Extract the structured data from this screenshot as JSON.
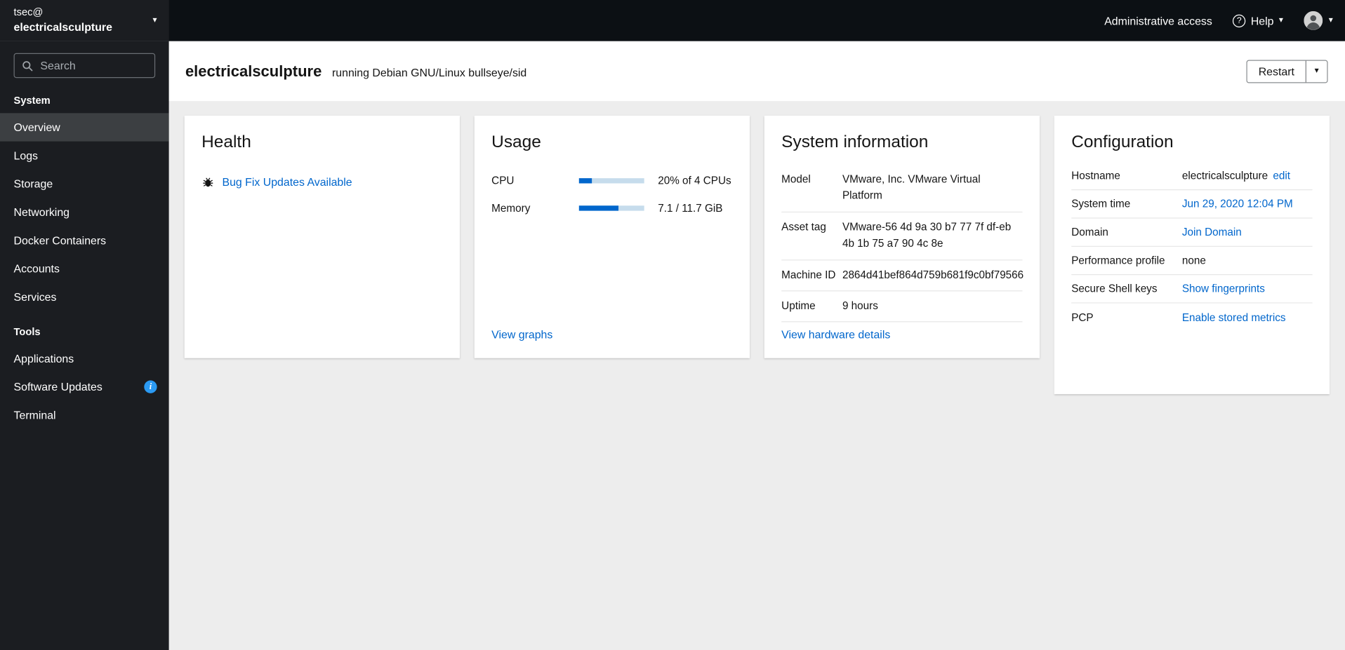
{
  "masthead": {
    "admin_access_label": "Administrative access",
    "help_label": "Help"
  },
  "sidebar": {
    "user_line1": "tsec@",
    "user_line2": "electricalsculpture",
    "search_placeholder": "Search",
    "sections": [
      {
        "label": "System",
        "items": [
          {
            "label": "Overview",
            "active": true
          },
          {
            "label": "Logs"
          },
          {
            "label": "Storage"
          },
          {
            "label": "Networking"
          },
          {
            "label": "Docker Containers"
          },
          {
            "label": "Accounts"
          },
          {
            "label": "Services"
          }
        ]
      },
      {
        "label": "Tools",
        "items": [
          {
            "label": "Applications"
          },
          {
            "label": "Software Updates",
            "badge": "info"
          },
          {
            "label": "Terminal"
          }
        ]
      }
    ]
  },
  "header": {
    "hostname": "electricalsculpture",
    "os_text": "running Debian GNU/Linux bullseye/sid",
    "restart_label": "Restart"
  },
  "cards": {
    "health": {
      "title": "Health",
      "updates_link": "Bug Fix Updates Available"
    },
    "usage": {
      "title": "Usage",
      "rows": [
        {
          "label": "CPU",
          "percent": 20,
          "text": "20% of 4 CPUs"
        },
        {
          "label": "Memory",
          "percent": 61,
          "text": "7.1 / 11.7 GiB"
        }
      ],
      "view_link": "View graphs"
    },
    "system_information": {
      "title": "System information",
      "rows": [
        {
          "label": "Model",
          "value": "VMware, Inc. VMware Virtual Platform"
        },
        {
          "label": "Asset tag",
          "value": "VMware-56 4d 9a 30 b7 77 7f df-eb 4b 1b 75 a7 90 4c 8e"
        },
        {
          "label": "Machine ID",
          "value": "2864d41bef864d759b681f9c0bf79566"
        },
        {
          "label": "Uptime",
          "value": "9 hours"
        }
      ],
      "view_link": "View hardware details"
    },
    "configuration": {
      "title": "Configuration",
      "rows": [
        {
          "label": "Hostname",
          "value": "electricalsculpture",
          "link": "edit"
        },
        {
          "label": "System time",
          "link": "Jun 29, 2020 12:04 PM"
        },
        {
          "label": "Domain",
          "link": "Join Domain"
        },
        {
          "label": "Performance profile",
          "value": "none"
        },
        {
          "label": "Secure Shell keys",
          "link": "Show fingerprints"
        },
        {
          "label": "PCP",
          "link": "Enable stored metrics"
        }
      ]
    }
  },
  "colors": {
    "accent_link": "#0066cc",
    "progress_fill": "#0066cc",
    "progress_track": "#c6dcec",
    "masthead_bg": "#0c1014",
    "sidebar_bg": "#1b1d21",
    "sidebar_active_bg": "#3c3f42",
    "content_bg": "#ededed",
    "info_badge": "#2b9af3"
  }
}
